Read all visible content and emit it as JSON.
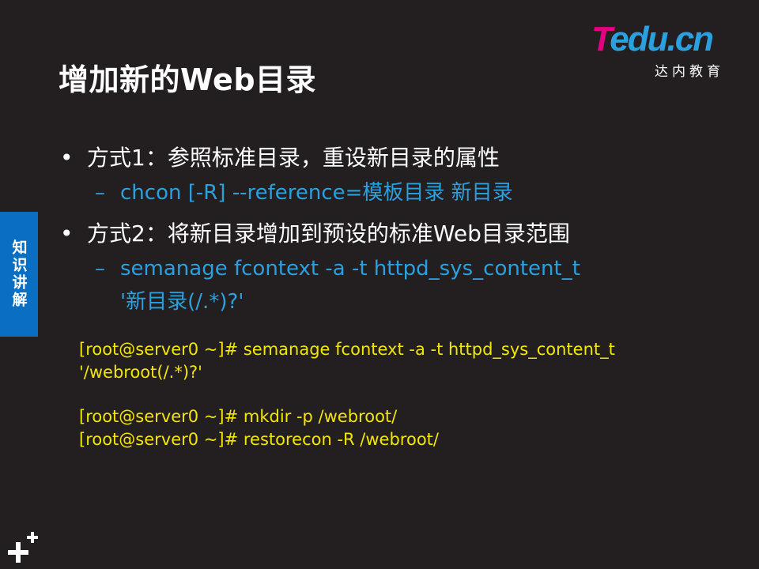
{
  "slide": {
    "title": "增加新的Web目录",
    "side_tab": "知识讲解"
  },
  "logo": {
    "main_t": "T",
    "main_rest": "edu.cn",
    "subtitle": "达内教育"
  },
  "bullets": [
    {
      "text": "方式1：参照标准目录，重设新目录的属性",
      "sub": "chcon  [-R]  --reference=模板目录  新目录"
    },
    {
      "text": "方式2：将新目录增加到预设的标准Web目录范围",
      "sub_line1": "semanage  fcontext  -a  -t  httpd_sys_content_t",
      "sub_line2": "'新目录(/.*)?'"
    }
  ],
  "code": {
    "line1": "[root@server0 ~]# semanage  fcontext  -a  -t  httpd_sys_content_t",
    "line2": "'/webroot(/.*)?'",
    "line3": "[root@server0 ~]# mkdir  -p  /webroot/",
    "line4": "[root@server0 ~]# restorecon  -R  /webroot/"
  },
  "colors": {
    "background": "#231f20",
    "title": "#ffffff",
    "accent_blue": "#2aa0de",
    "code_yellow": "#f3e600",
    "tab_blue": "#0a6fc2",
    "logo_pink": "#e4007f"
  },
  "icons": {
    "bottom_left": "plus-icon"
  }
}
